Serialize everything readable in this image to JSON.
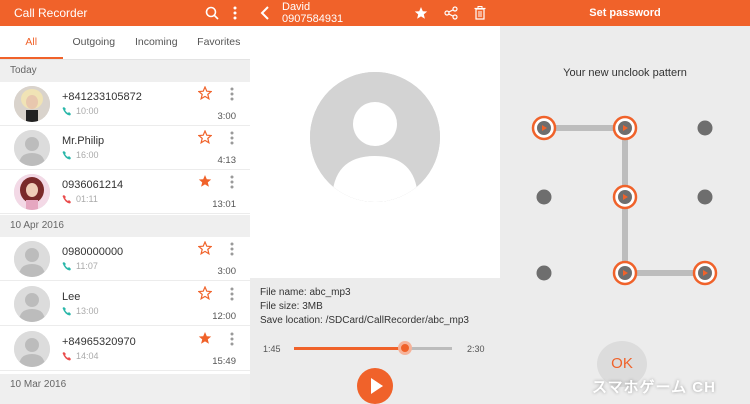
{
  "colors": {
    "accent": "#f0622a",
    "accent_light": "#f6b39a",
    "star_empty": "#f0622a",
    "incoming": "#2ab7a9",
    "outgoing": "#e94c4c"
  },
  "recorder": {
    "title": "Call Recorder",
    "tabs": [
      "All",
      "Outgoing",
      "Incoming",
      "Favorites"
    ],
    "active_tab": "All",
    "sections": [
      {
        "label": "Today"
      },
      {
        "label": "10 Apr 2016"
      },
      {
        "label": "10 Mar 2016"
      }
    ],
    "rows": [
      {
        "name": "+841233105872",
        "time": "10:00",
        "duration": "3:00",
        "call_type": "incoming",
        "favorite": false,
        "avatar": "photo-blonde"
      },
      {
        "name": "Mr.Philip",
        "time": "16:00",
        "duration": "4:13",
        "call_type": "incoming",
        "favorite": false,
        "avatar": "placeholder"
      },
      {
        "name": "0936061214",
        "time": "01:11",
        "duration": "13:01",
        "call_type": "outgoing",
        "favorite": true,
        "avatar": "photo-redhair"
      },
      {
        "name": "0980000000",
        "time": "11:07",
        "duration": "3:00",
        "call_type": "incoming",
        "favorite": false,
        "avatar": "placeholder"
      },
      {
        "name": "Lee",
        "time": "13:00",
        "duration": "12:00",
        "call_type": "incoming",
        "favorite": false,
        "avatar": "placeholder"
      },
      {
        "name": "+84965320970",
        "time": "14:04",
        "duration": "15:49",
        "call_type": "outgoing",
        "favorite": true,
        "avatar": "placeholder"
      }
    ]
  },
  "detail": {
    "name": "David",
    "number": "0907584931",
    "file_name": "File name: abc_mp3",
    "file_size": "File size: 3MB",
    "save_location": "Save location: /SDCard/CallRecorder/abc_mp3",
    "elapsed": "1:45",
    "total": "2:30",
    "progress": 0.7
  },
  "password": {
    "title": "Set password",
    "subtitle": "Your new unclook pattern",
    "ok_label": "OK",
    "watermark": "スマホゲーム CH",
    "grid": 4,
    "pattern_path": [
      0,
      1,
      5,
      9,
      10,
      11
    ],
    "selected_dots": [
      0,
      1,
      5,
      9,
      10,
      11
    ]
  }
}
